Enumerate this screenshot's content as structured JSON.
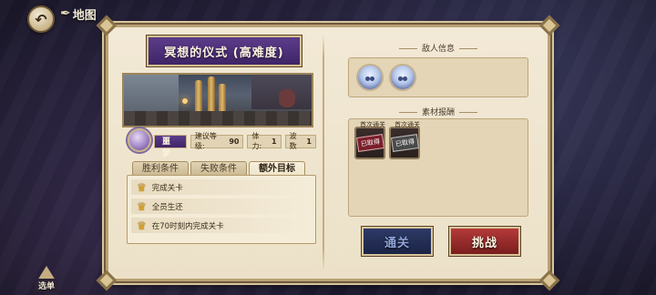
{
  "nav": {
    "back_icon": "back-arrow-icon",
    "map_label": "地图"
  },
  "stage": {
    "title": "冥想的仪式 (高难度)",
    "difficulty": "噩梦",
    "level_label": "建议等级:",
    "level_value": "90",
    "stamina_label": "体力:",
    "stamina_value": "1",
    "waves_label": "波数",
    "waves_value": "1"
  },
  "tabs": [
    {
      "label": "胜利条件",
      "active": false
    },
    {
      "label": "失败条件",
      "active": false
    },
    {
      "label": "额外目标",
      "active": true
    }
  ],
  "goals": [
    {
      "text": "完成关卡"
    },
    {
      "text": "全员生还"
    },
    {
      "text": "在70时刻内完成关卡"
    }
  ],
  "enemy_section": {
    "label": "敌人信息"
  },
  "reward_section": {
    "label": "素材报酬",
    "items": [
      {
        "caption": "首次通关",
        "status": "已取得"
      },
      {
        "caption": "首次通关",
        "status": "已取得"
      }
    ]
  },
  "buttons": {
    "clear": "通关",
    "challenge": "挑战"
  },
  "menu": {
    "label": "选单"
  },
  "colors": {
    "title_banner": "#4a2e75",
    "challenge_button": "#9c2b2b",
    "clear_button": "#24305a",
    "panel_bg": "#efe5cf"
  }
}
